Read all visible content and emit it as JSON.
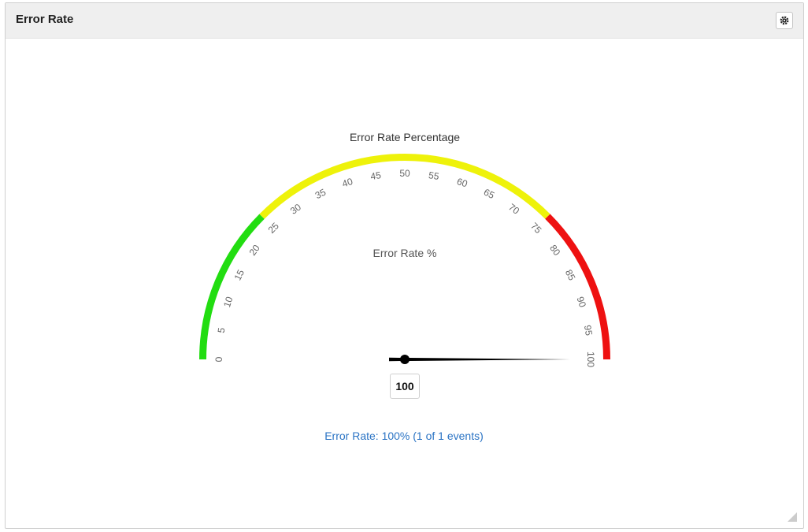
{
  "panel": {
    "title": "Error Rate",
    "settings_icon": "gear-icon"
  },
  "chart_data": {
    "type": "gauge",
    "title": "Error Rate Percentage",
    "subtitle": "Error Rate %",
    "min": 0,
    "max": 100,
    "tick_step": 5,
    "tick_labels": [
      "0",
      "5",
      "10",
      "15",
      "20",
      "25",
      "30",
      "35",
      "40",
      "45",
      "50",
      "55",
      "60",
      "65",
      "70",
      "75",
      "80",
      "85",
      "90",
      "95",
      "100"
    ],
    "bands": [
      {
        "from": 0,
        "to": 25,
        "color": "#22dd11"
      },
      {
        "from": 25,
        "to": 75,
        "color": "#eef20a"
      },
      {
        "from": 75,
        "to": 100,
        "color": "#ee1111"
      }
    ],
    "value": 100,
    "value_label": "100",
    "caption": "Error Rate: 100% (1 of 1 events)"
  },
  "colors": {
    "caption": "#2a73c4",
    "needle": "#000000"
  }
}
